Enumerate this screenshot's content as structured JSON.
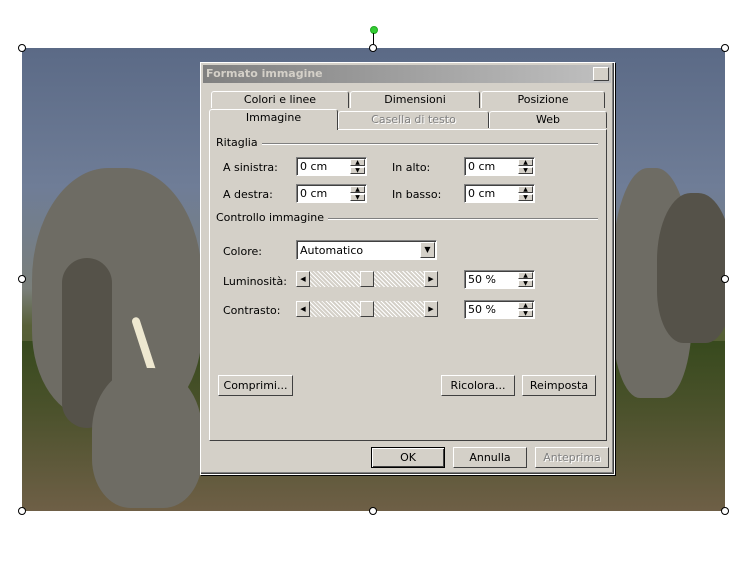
{
  "dialog": {
    "title": "Formato immagine",
    "close_glyph": "✕"
  },
  "tabs": {
    "row_back": [
      "Colori e linee",
      "Dimensioni",
      "Posizione"
    ],
    "row_front": [
      "Immagine",
      "Casella di testo",
      "Web"
    ],
    "active": "Immagine",
    "disabled": "Casella di testo"
  },
  "crop": {
    "group_label": "Ritaglia",
    "left_label": "A sinistra:",
    "left_value": "0 cm",
    "top_label": "In alto:",
    "top_value": "0 cm",
    "right_label": "A destra:",
    "right_value": "0 cm",
    "bottom_label": "In basso:",
    "bottom_value": "0 cm"
  },
  "image_control": {
    "group_label": "Controllo immagine",
    "color_label": "Colore:",
    "color_value": "Automatico",
    "brightness_label": "Luminosità:",
    "brightness_value": "50 %",
    "brightness_level": 0.5,
    "contrast_label": "Contrasto:",
    "contrast_value": "50 %",
    "contrast_level": 0.5
  },
  "buttons": {
    "compress": "Comprimi...",
    "recolor": "Ricolora...",
    "reset": "Reimposta",
    "ok": "OK",
    "cancel": "Annulla",
    "preview": "Anteprima"
  },
  "icons": {
    "spin_up": "▲",
    "spin_down": "▼",
    "dropdown": "▼",
    "scroll_left": "◀",
    "scroll_right": "▶"
  }
}
